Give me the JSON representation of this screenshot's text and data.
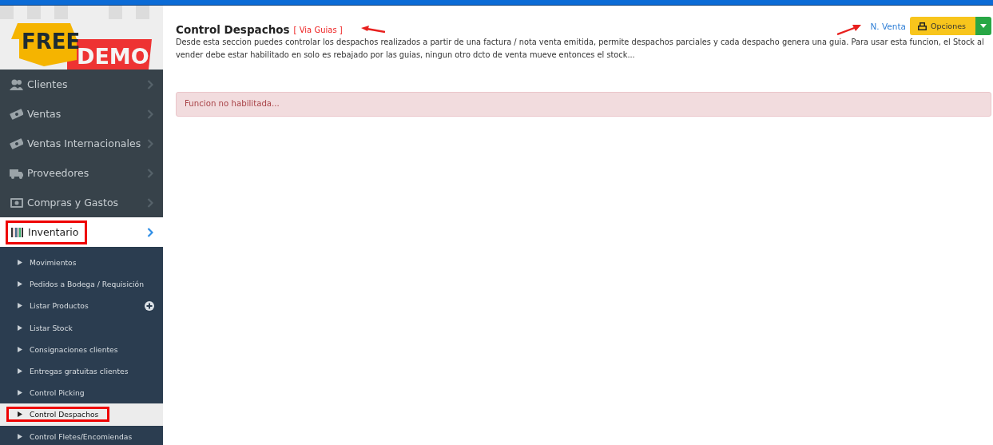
{
  "logo": {
    "word_1": "FREE",
    "word_2": "DEMO"
  },
  "sidebar": {
    "items": [
      {
        "label": "Clientes",
        "kind": "users",
        "selected": false,
        "annotated": false
      },
      {
        "label": "Ventas",
        "kind": "money",
        "selected": false,
        "annotated": false
      },
      {
        "label": "Ventas Internacionales",
        "kind": "money",
        "selected": false,
        "annotated": false
      },
      {
        "label": "Proveedores",
        "kind": "truck",
        "selected": false,
        "annotated": false
      },
      {
        "label": "Compras y Gastos",
        "kind": "cash",
        "selected": false,
        "annotated": false
      },
      {
        "label": "Inventario",
        "kind": "barcode",
        "selected": true,
        "annotated": true,
        "children": [
          {
            "label": "Movimientos",
            "selected": false,
            "annotated": false
          },
          {
            "label": "Pedidos a Bodega / Requisición",
            "selected": false,
            "annotated": false
          },
          {
            "label": "Listar Productos",
            "selected": false,
            "annotated": false,
            "add": true
          },
          {
            "label": "Listar Stock",
            "selected": false,
            "annotated": false
          },
          {
            "label": "Consignaciones clientes",
            "selected": false,
            "annotated": false
          },
          {
            "label": "Entregas gratuitas clientes",
            "selected": false,
            "annotated": false
          },
          {
            "label": "Control Picking",
            "selected": false,
            "annotated": false
          },
          {
            "label": "Control Despachos",
            "selected": true,
            "annotated": true
          },
          {
            "label": "Control Fletes/Encomiendas",
            "selected": false,
            "annotated": false
          }
        ]
      }
    ]
  },
  "header": {
    "title": "Control Despachos",
    "subtitle": "[ Via Guias ]",
    "title_arrow": true,
    "link": "N. Venta",
    "link_arrow": true,
    "options_button": "Opciones",
    "description": "Desde esta seccion puedes controlar los despachos realizados a partir de una factura / nota venta emitida, permite despachos parciales y cada despacho genera una guia. Para usar esta funcion, el Stock al vender debe estar habilitado en solo es rebajado por las guias, ningun otro dcto de venta mueve entonces el stock..."
  },
  "alert": {
    "message": "Funcion no habilitada..."
  }
}
